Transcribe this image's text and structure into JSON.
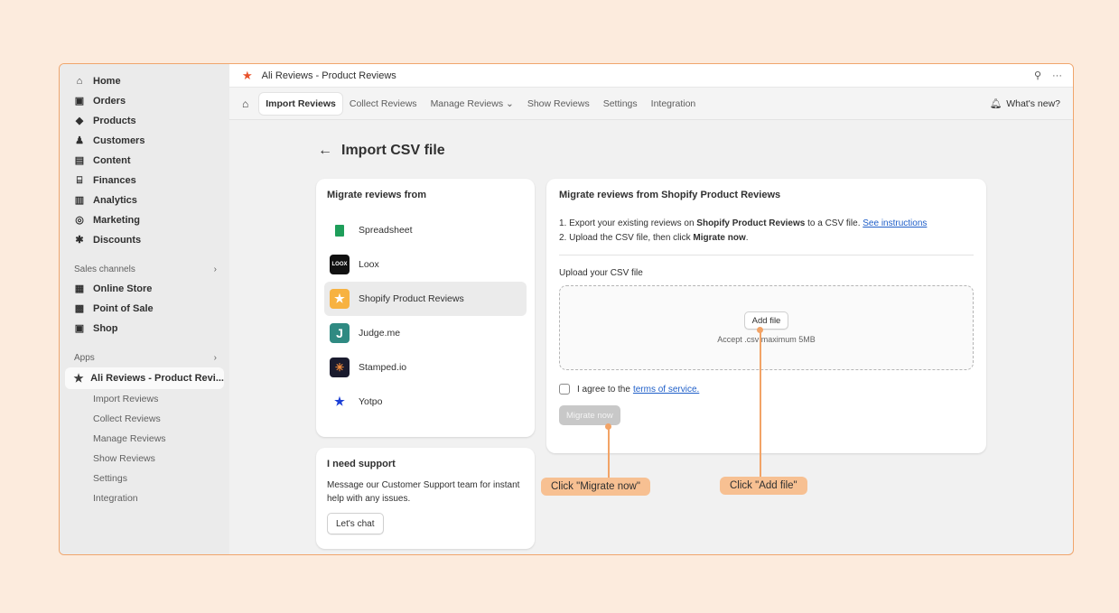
{
  "sidebar": {
    "items": [
      {
        "label": "Home",
        "icon": "home-icon"
      },
      {
        "label": "Orders",
        "icon": "orders-icon"
      },
      {
        "label": "Products",
        "icon": "products-icon"
      },
      {
        "label": "Customers",
        "icon": "customers-icon"
      },
      {
        "label": "Content",
        "icon": "content-icon"
      },
      {
        "label": "Finances",
        "icon": "finances-icon"
      },
      {
        "label": "Analytics",
        "icon": "analytics-icon"
      },
      {
        "label": "Marketing",
        "icon": "marketing-icon"
      },
      {
        "label": "Discounts",
        "icon": "discounts-icon"
      }
    ],
    "sales_channels_label": "Sales channels",
    "sales_channels": [
      {
        "label": "Online Store"
      },
      {
        "label": "Point of Sale"
      },
      {
        "label": "Shop"
      }
    ],
    "apps_label": "Apps",
    "active_app": "Ali Reviews - Product Revi...",
    "app_subitems": [
      "Import Reviews",
      "Collect Reviews",
      "Manage Reviews",
      "Show Reviews",
      "Settings",
      "Integration"
    ]
  },
  "titlebar": {
    "title": "Ali Reviews - Product Reviews"
  },
  "tabs": [
    {
      "label": "Import Reviews"
    },
    {
      "label": "Collect Reviews"
    },
    {
      "label": "Manage Reviews ⌄"
    },
    {
      "label": "Show Reviews"
    },
    {
      "label": "Settings"
    },
    {
      "label": "Integration"
    }
  ],
  "whats_new": "What's new?",
  "page": {
    "title": "Import CSV file"
  },
  "sources_card": {
    "title": "Migrate reviews from",
    "sources": [
      {
        "label": "Spreadsheet",
        "logo": ""
      },
      {
        "label": "Loox",
        "logo": "LOOX"
      },
      {
        "label": "Shopify Product Reviews",
        "logo": "★"
      },
      {
        "label": "Judge.me",
        "logo": "J"
      },
      {
        "label": "Stamped.io",
        "logo": "✳"
      },
      {
        "label": "Yotpo",
        "logo": "★"
      }
    ]
  },
  "support_card": {
    "title": "I need support",
    "text": "Message our Customer Support team for instant help with any issues.",
    "button": "Let's chat"
  },
  "migrate_card": {
    "title": "Migrate reviews from Shopify Product Reviews",
    "step1_prefix": "1. Export your existing reviews on ",
    "step1_bold": "Shopify Product Reviews",
    "step1_suffix": " to a CSV file. ",
    "step1_link": "See instructions",
    "step2_prefix": "2. Upload the CSV file, then click ",
    "step2_bold": "Migrate now",
    "step2_suffix": ".",
    "upload_label": "Upload your CSV file",
    "add_file": "Add file",
    "accept": "Accept .csv maximum 5MB",
    "agree_prefix": "I agree to the ",
    "agree_link": "terms of service.",
    "migrate_button": "Migrate now"
  },
  "callouts": {
    "migrate": "Click \"Migrate now\"",
    "add_file": "Click \"Add file\""
  },
  "colors": {
    "accent_orange": "#f2a366",
    "brand_red": "#e8522b",
    "link_blue": "#1f5fc9"
  }
}
